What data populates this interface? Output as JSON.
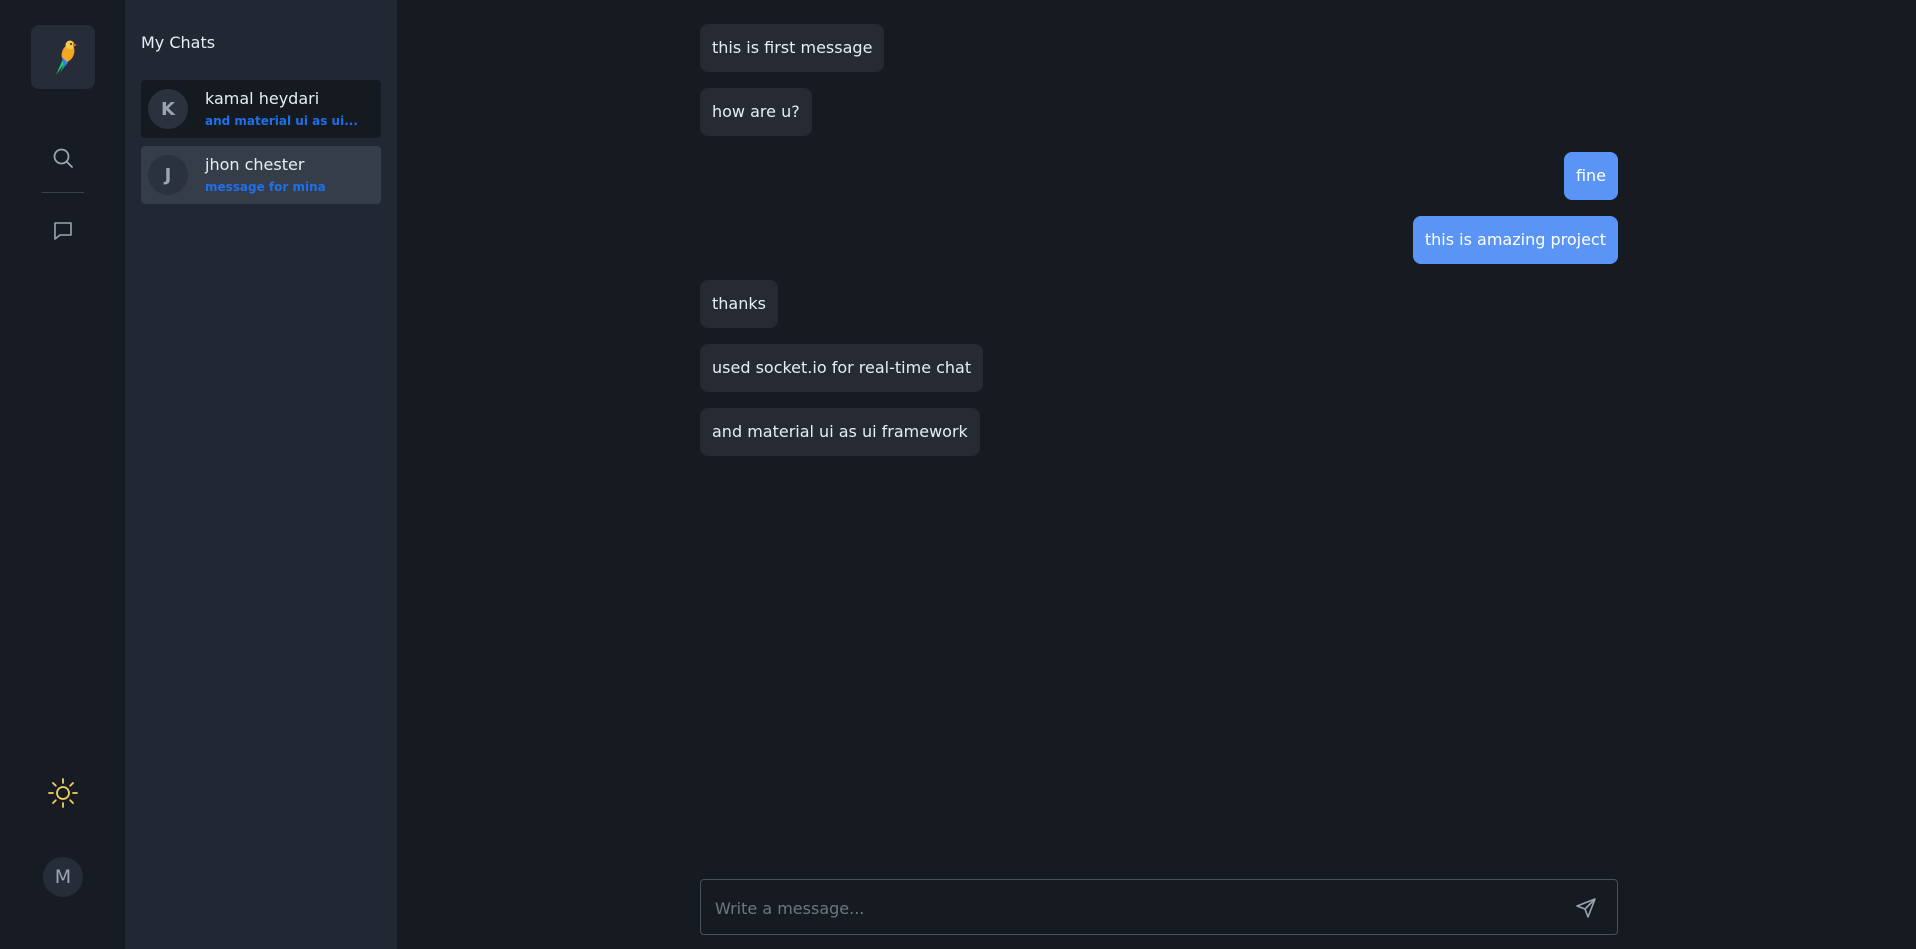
{
  "rail": {
    "logo_icon": "parrot-logo-icon",
    "search_icon": "search-icon",
    "chats_icon": "chat-bubble-icon",
    "theme_icon": "sun-icon",
    "user_initial": "M",
    "colors": {
      "sun": "#f2d25a"
    }
  },
  "chatlist": {
    "title": "My Chats",
    "items": [
      {
        "initial": "K",
        "name": "kamal heydari",
        "preview": "and material ui as ui...",
        "state": "active"
      },
      {
        "initial": "J",
        "name": "jhon chester",
        "preview": "message for mina",
        "state": "hover"
      }
    ]
  },
  "messages": [
    {
      "text": "this is first message",
      "direction": "in"
    },
    {
      "text": "how are u?",
      "direction": "in"
    },
    {
      "text": "fine",
      "direction": "out"
    },
    {
      "text": "this is amazing project",
      "direction": "out"
    },
    {
      "text": "thanks",
      "direction": "in"
    },
    {
      "text": "used socket.io for real-time chat",
      "direction": "in"
    },
    {
      "text": "and material ui as ui framework",
      "direction": "in"
    }
  ],
  "composer": {
    "placeholder": "Write a message...",
    "value": "",
    "send_icon": "send-icon"
  },
  "colors": {
    "accent": "#1f6feb",
    "outgoing_bubble": "#5a95f5",
    "incoming_bubble": "#262b33"
  }
}
